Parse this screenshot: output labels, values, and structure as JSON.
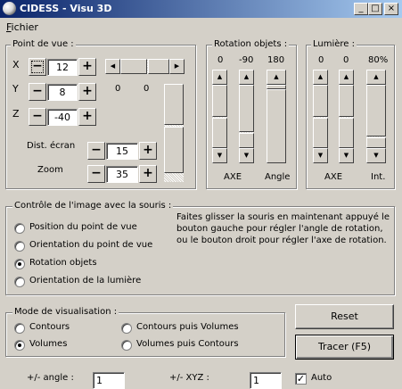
{
  "window": {
    "title": "CIDESS - Visu 3D",
    "minimize_glyph": "_",
    "maximize_glyph": "□",
    "close_glyph": "×"
  },
  "menu": {
    "items": [
      "Fichier"
    ]
  },
  "point_de_vue": {
    "title": "Point de vue :",
    "x_label": "X",
    "x_value": "12",
    "y_label": "Y",
    "y_value": "8",
    "z_label": "Z",
    "z_value": "-40",
    "minus": "−",
    "plus": "+",
    "h_readout_1": "0",
    "h_readout_2": "0",
    "dist_label": "Dist. écran",
    "dist_value": "15",
    "zoom_label": "Zoom",
    "zoom_value": "35"
  },
  "rotation_objets": {
    "title": "Rotation objets :",
    "values": [
      "0",
      "-90",
      "180"
    ],
    "label_axe": "AXE",
    "label_angle": "Angle"
  },
  "lumiere": {
    "title": "Lumière :",
    "values": [
      "0",
      "0",
      "80%"
    ],
    "label_axe": "AXE",
    "label_int": "Int."
  },
  "controle": {
    "title": "Contrôle de l'image avec la souris :",
    "options": [
      "Position du point de vue",
      "Orientation du point de vue",
      "Rotation objets",
      "Orientation de la lumière"
    ],
    "selected": 2,
    "help": "Faites glisser la souris en maintenant appuyé le bouton gauche pour régler l'angle de rotation, ou le bouton droit pour régler l'axe de rotation."
  },
  "mode": {
    "title": "Mode de visualisation :",
    "options": [
      "Contours",
      "Volumes",
      "Contours puis Volumes",
      "Volumes puis Contours"
    ],
    "selected": 1
  },
  "buttons": {
    "reset": "Reset",
    "tracer": "Tracer (F5)"
  },
  "bottom": {
    "angle_label": "+/- angle :",
    "angle_value": "1",
    "xyz_label": "+/- XYZ :",
    "xyz_value": "1",
    "auto_label": "Auto",
    "auto_checked": true
  },
  "scroll_glyphs": {
    "up": "▲",
    "down": "▼",
    "left": "◀",
    "right": "▶"
  }
}
